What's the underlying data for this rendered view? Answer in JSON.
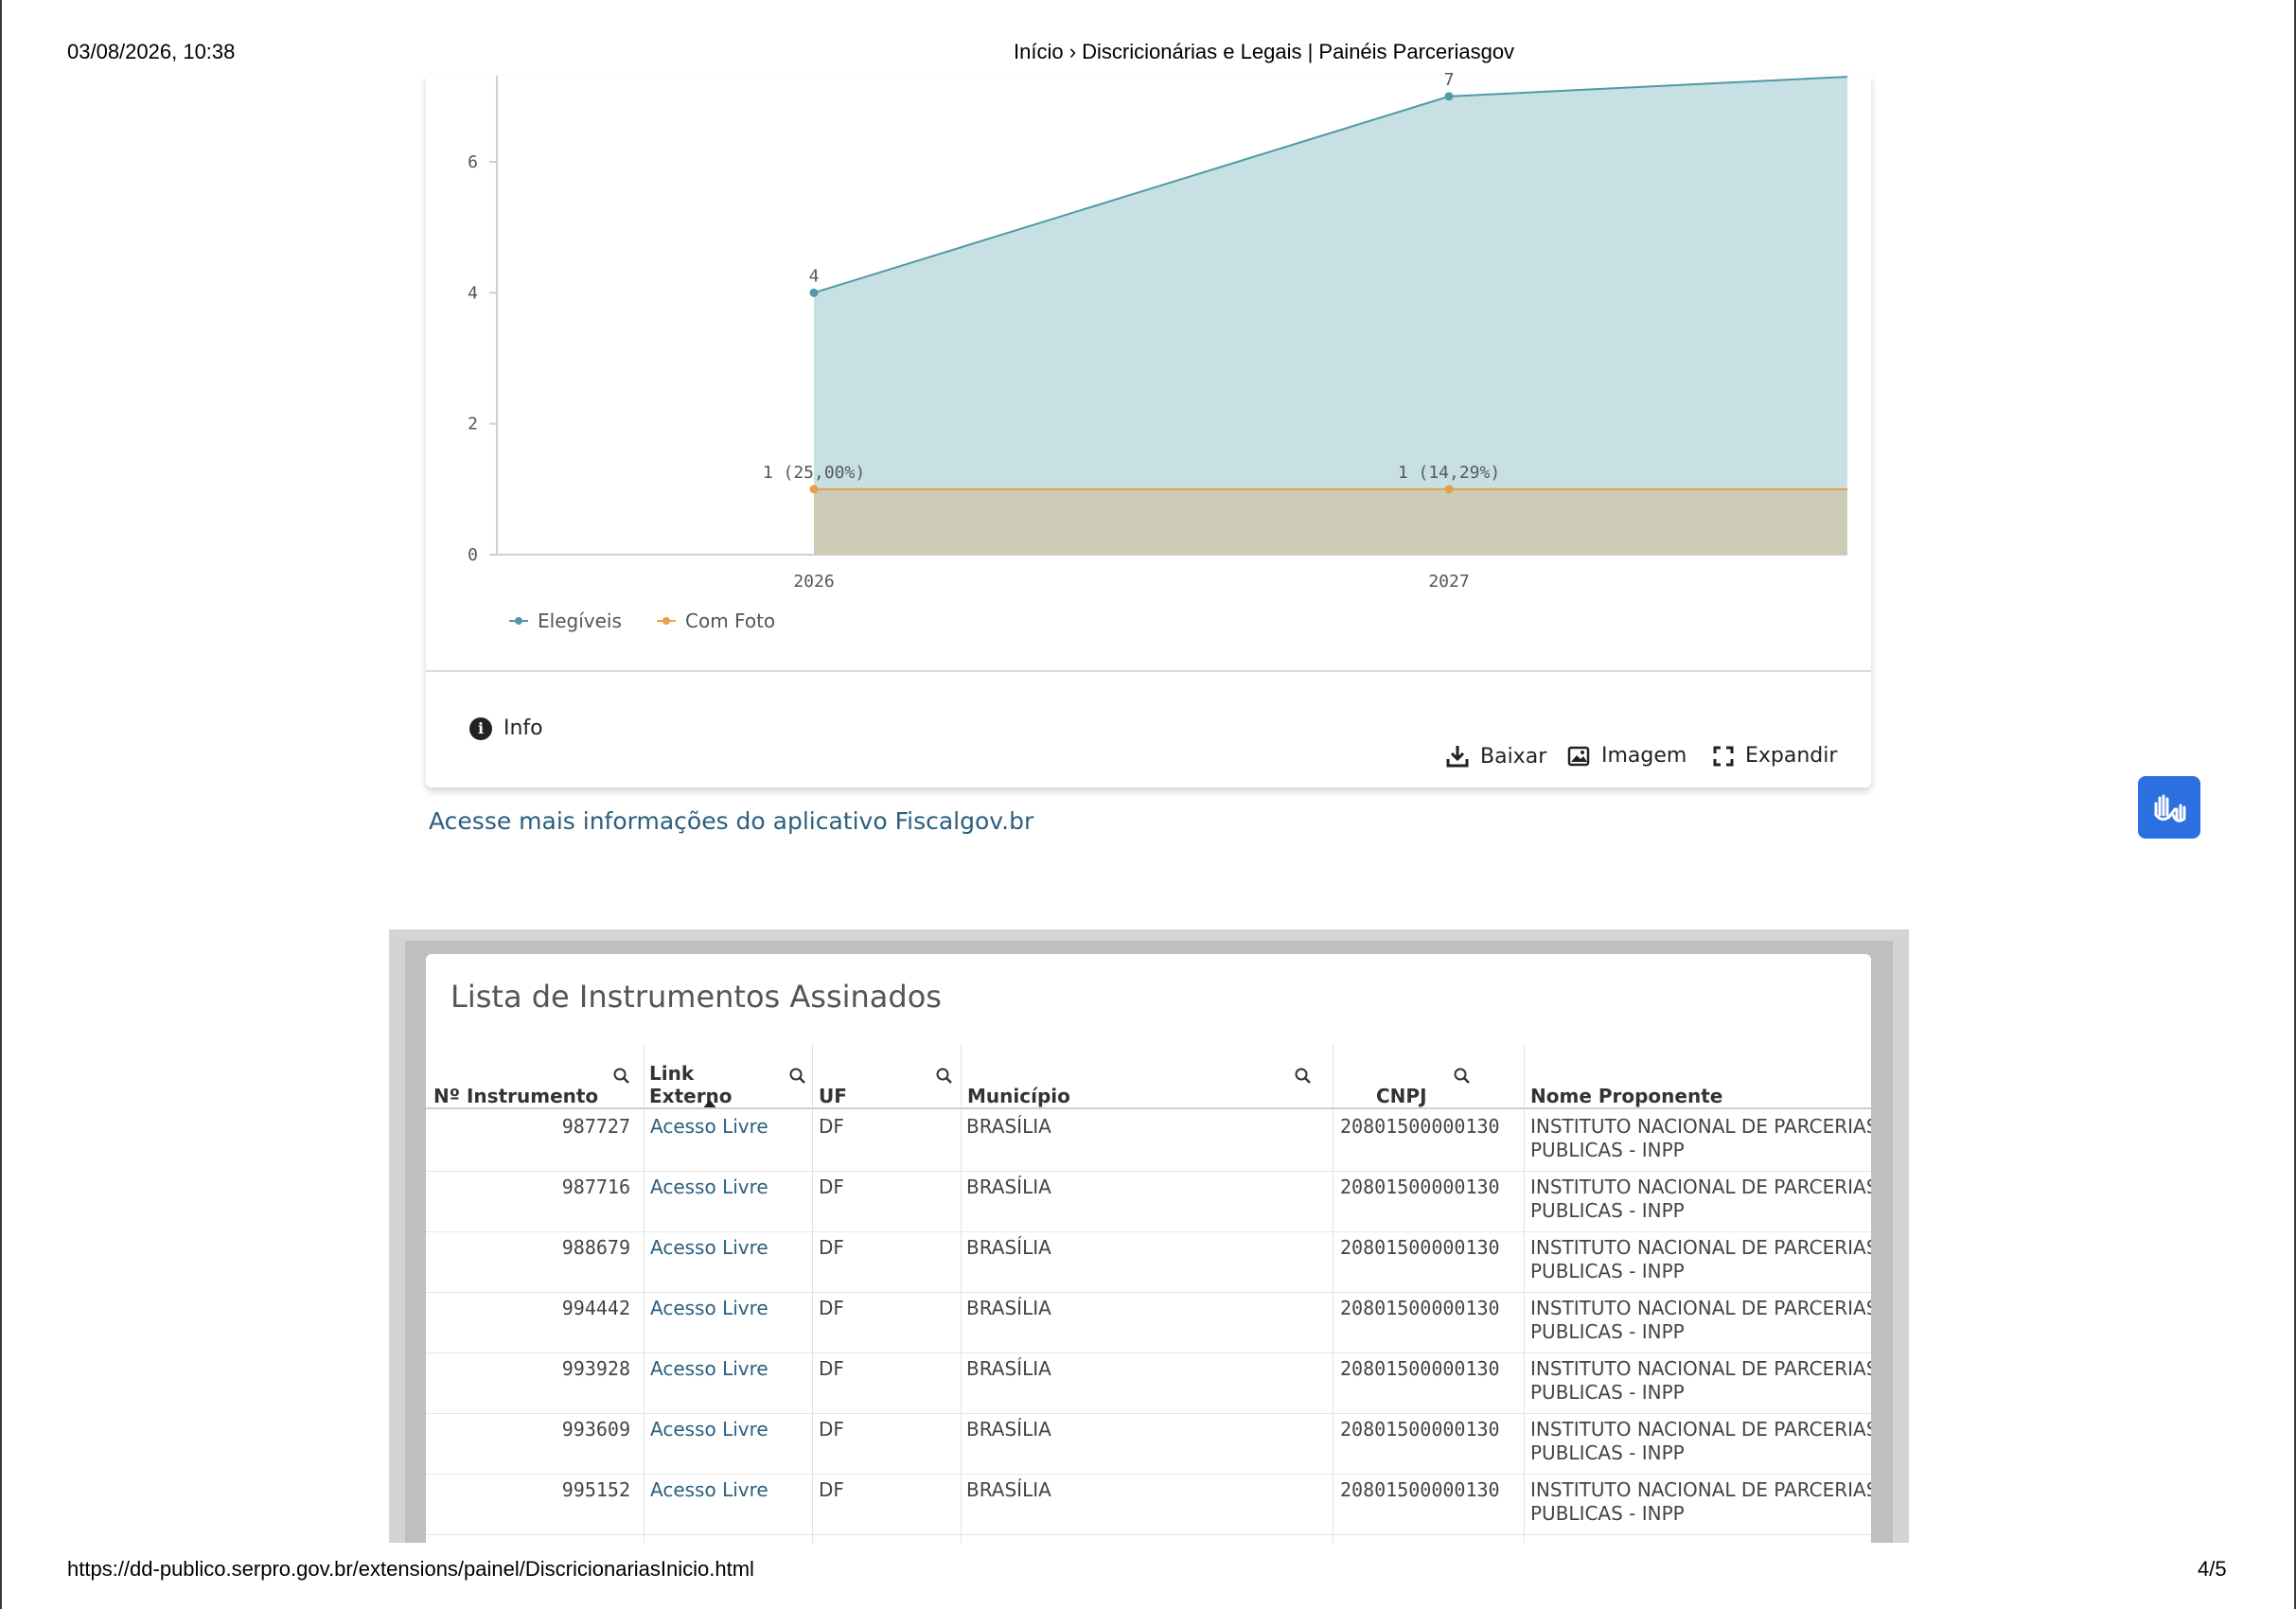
{
  "print": {
    "datetime": "03/08/2026, 10:38",
    "title": "Início › Discricionárias e Legais | Painéis Parceriasgov",
    "url": "https://dd-publico.serpro.gov.br/extensions/painel/DiscricionariasInicio.html",
    "page": "4/5"
  },
  "chart_data": {
    "type": "area",
    "x": [
      "2026",
      "2027",
      ""
    ],
    "series": [
      {
        "name": "Elegíveis",
        "values": [
          4,
          7,
          7.3
        ],
        "labels": [
          "4",
          "7",
          ""
        ],
        "color": "#4f9aa6",
        "fill": "#c7e0e3"
      },
      {
        "name": "Com Foto",
        "values": [
          1,
          1,
          1
        ],
        "labels": [
          "1 (25,00%)",
          "1 (14,29%)",
          ""
        ],
        "color": "#e5a04d",
        "fill": "#ccccb6"
      }
    ],
    "y_ticks": [
      "0",
      "2",
      "4",
      "6"
    ],
    "x_ticks": [
      "2026",
      "2027"
    ],
    "ylim": [
      0,
      7.3
    ],
    "legend_position": "bottom-left",
    "grid": false
  },
  "card_actions": {
    "info": "Info",
    "download": "Baixar",
    "image": "Imagem",
    "expand": "Expandir"
  },
  "app_link": "Acesse mais informações do aplicativo Fiscalgov.br",
  "table": {
    "title": "Lista de Instrumentos Assinados",
    "columns": {
      "instrumento": "Nº Instrumento",
      "link_line1": "Link",
      "link_line2": "Externo",
      "uf": "UF",
      "municipio": "Município",
      "cnpj": "CNPJ",
      "proponente": "Nome Proponente"
    },
    "rows": [
      {
        "instrumento": "987727",
        "link": "Acesso Livre",
        "uf": "DF",
        "municipio": "BRASÍLIA",
        "cnpj": "20801500000130",
        "proponente_l1": "INSTITUTO NACIONAL DE PARCERIAS",
        "proponente_l2": "PUBLICAS - INPP"
      },
      {
        "instrumento": "987716",
        "link": "Acesso Livre",
        "uf": "DF",
        "municipio": "BRASÍLIA",
        "cnpj": "20801500000130",
        "proponente_l1": "INSTITUTO NACIONAL DE PARCERIAS",
        "proponente_l2": "PUBLICAS - INPP"
      },
      {
        "instrumento": "988679",
        "link": "Acesso Livre",
        "uf": "DF",
        "municipio": "BRASÍLIA",
        "cnpj": "20801500000130",
        "proponente_l1": "INSTITUTO NACIONAL DE PARCERIAS",
        "proponente_l2": "PUBLICAS - INPP"
      },
      {
        "instrumento": "994442",
        "link": "Acesso Livre",
        "uf": "DF",
        "municipio": "BRASÍLIA",
        "cnpj": "20801500000130",
        "proponente_l1": "INSTITUTO NACIONAL DE PARCERIAS",
        "proponente_l2": "PUBLICAS - INPP"
      },
      {
        "instrumento": "993928",
        "link": "Acesso Livre",
        "uf": "DF",
        "municipio": "BRASÍLIA",
        "cnpj": "20801500000130",
        "proponente_l1": "INSTITUTO NACIONAL DE PARCERIAS",
        "proponente_l2": "PUBLICAS - INPP"
      },
      {
        "instrumento": "993609",
        "link": "Acesso Livre",
        "uf": "DF",
        "municipio": "BRASÍLIA",
        "cnpj": "20801500000130",
        "proponente_l1": "INSTITUTO NACIONAL DE PARCERIAS",
        "proponente_l2": "PUBLICAS - INPP"
      },
      {
        "instrumento": "995152",
        "link": "Acesso Livre",
        "uf": "DF",
        "municipio": "BRASÍLIA",
        "cnpj": "20801500000130",
        "proponente_l1": "INSTITUTO NACIONAL DE PARCERIAS",
        "proponente_l2": "PUBLICAS - INPP"
      }
    ]
  }
}
